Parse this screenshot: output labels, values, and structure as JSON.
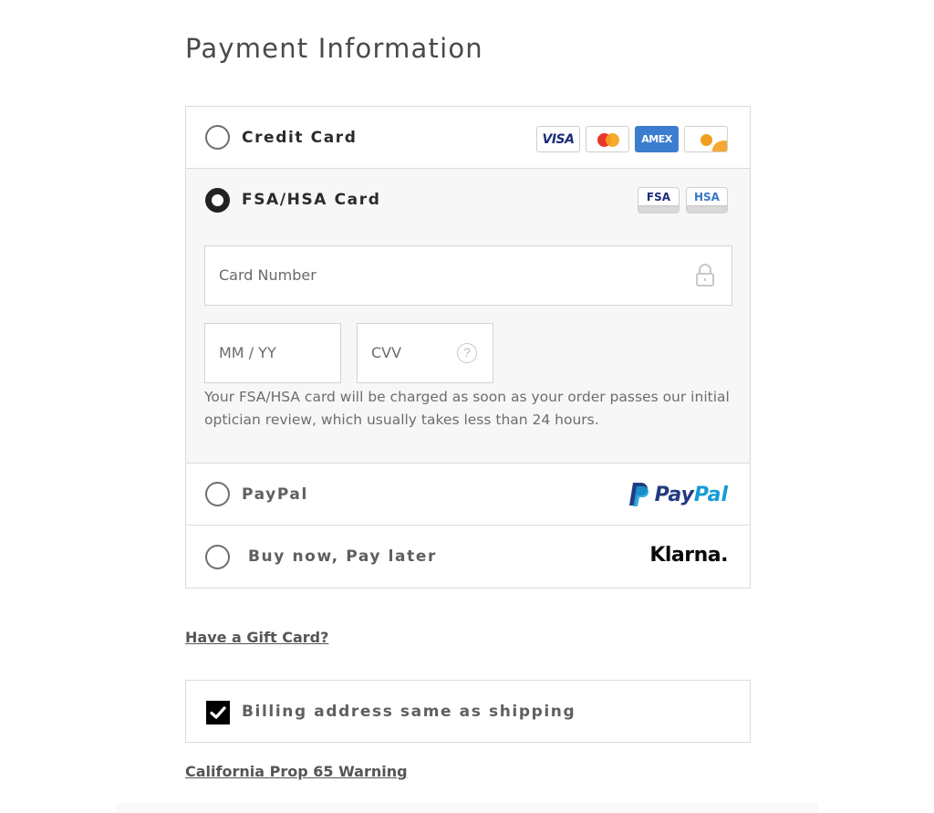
{
  "page": {
    "title": "Payment Information"
  },
  "payment_options": {
    "credit_card": {
      "label": "Credit Card",
      "selected": false,
      "card_brands": [
        "visa-logo",
        "mastercard-logo",
        "amex-logo",
        "discover-logo"
      ],
      "visa_text": "VISA",
      "amex_text": "AMEX"
    },
    "fsa_hsa": {
      "label": "FSA/HSA Card",
      "selected": true,
      "badges": [
        "FSA",
        "HSA"
      ],
      "colors": {
        "fsa": "#1d2f7d",
        "hsa": "#3a77c9"
      },
      "card_number_placeholder": "Card Number",
      "expiry_placeholder": "MM / YY",
      "cvv_placeholder": "CVV",
      "cvv_help": "?",
      "note": "Your FSA/HSA card will be charged as soon as your order passes our initial optician review, which usually takes less than 24 hours."
    },
    "paypal": {
      "label": "PayPal",
      "selected": false,
      "logo_pay": "Pay",
      "logo_pal": "Pal",
      "colors": {
        "dark": "#253b80",
        "light": "#179bd7"
      }
    },
    "klarna": {
      "label": "Buy now, Pay later",
      "selected": false,
      "logo_text": "Klarna."
    }
  },
  "links": {
    "gift_card": "Have a Gift Card?",
    "prop65": "California Prop 65 Warning"
  },
  "billing": {
    "label": "Billing address same as shipping",
    "checked": true
  }
}
